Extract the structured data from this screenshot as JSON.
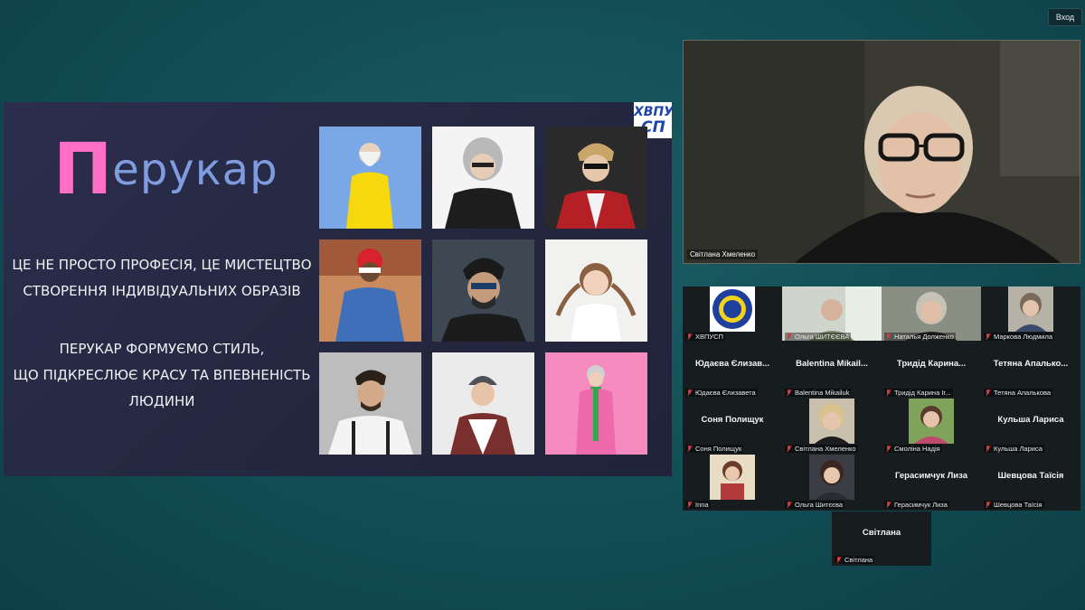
{
  "top_bar": {
    "login_label": "Вход"
  },
  "slide": {
    "logo_text_1": "ХВПУ",
    "logo_text_2": "СП",
    "title_first": "П",
    "title_rest": "ерукар",
    "text1_line1": "ЦЕ НЕ ПРОСТО ПРОФЕСІЯ, ЦЕ МИСТЕЦТВО",
    "text1_line2": "СТВОРЕННЯ ІНДИВІДУАЛЬНИХ ОБРАЗІВ",
    "text2_line1": "ПЕРУКАР ФОРМУЄМО СТИЛЬ,",
    "text2_line2": "ЩО ПІДКРЕСЛЮЄ КРАСУ ТА ВПЕВНЕНІСТЬ",
    "text2_line3": "ЛЮДИНИ"
  },
  "speaker": {
    "name": "Світлана Хмеленко"
  },
  "participants": [
    {
      "label": "ХВПУСП",
      "big": "",
      "thumb": "logo"
    },
    {
      "label": "Ольга ШИТЄЄВА",
      "big": "",
      "thumb": "video"
    },
    {
      "label": "Наталья Долженко",
      "big": "",
      "thumb": "video"
    },
    {
      "label": "Маркова Людмила",
      "big": "",
      "thumb": "video"
    },
    {
      "label": "Юдаєва Єлизавета",
      "big": "Юдаєва Єлизав...",
      "thumb": ""
    },
    {
      "label": "Balentina Mikailuk",
      "big": "Balentina Mikail...",
      "thumb": ""
    },
    {
      "label": "Тридід Карина Ir...",
      "big": "Тридід Карина...",
      "thumb": ""
    },
    {
      "label": "Тетяна Апалькова",
      "big": "Тетяна Апалько...",
      "thumb": ""
    },
    {
      "label": "Соня Полищук",
      "big": "Соня Полищук",
      "thumb": ""
    },
    {
      "label": "Світлана Хмеленко",
      "big": "",
      "thumb": "video"
    },
    {
      "label": "Смоліна Надія",
      "big": "",
      "thumb": "video"
    },
    {
      "label": "Кульша Лариса",
      "big": "Кульша Лариса",
      "thumb": ""
    },
    {
      "label": "Inna",
      "big": "",
      "thumb": "video"
    },
    {
      "label": "Ольга Шитєєва",
      "big": "",
      "thumb": "video"
    },
    {
      "label": "Герасимчук Лиза",
      "big": "Герасимчук Лиза",
      "thumb": ""
    },
    {
      "label": "Шевцова Таїсія",
      "big": "Шевцова Таїсія",
      "thumb": ""
    }
  ],
  "extra_participant": {
    "label": "Світлана",
    "big": "Світлана"
  },
  "colors": {
    "background": "#124c54",
    "slide": "#24273f",
    "title_accent": "#ff6fc6",
    "title_main": "#7f9ce0",
    "muted_mic": "#d63a3a"
  }
}
